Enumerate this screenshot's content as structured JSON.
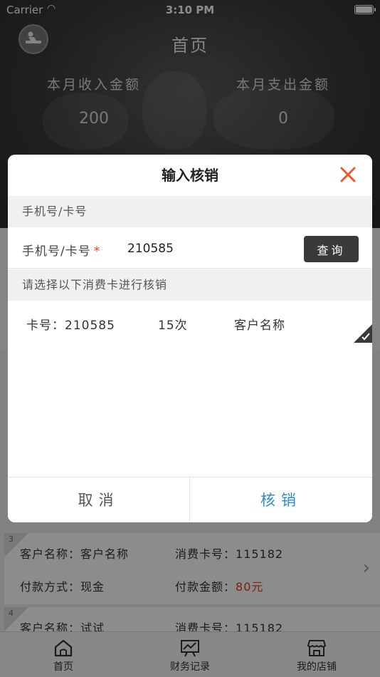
{
  "status_bar": {
    "carrier": "Carrier",
    "time": "3:10 PM"
  },
  "header": {
    "title": "首页",
    "income_label": "本月收入金额",
    "income_value": "200",
    "expense_label": "本月支出金额",
    "expense_value": "0"
  },
  "records": [
    {
      "index": "3",
      "customer_label": "客户名称：",
      "customer_value": "客户名称",
      "card_label": "消费卡号：",
      "card_value": "115182",
      "pay_method_label": "付款方式：",
      "pay_method_value": "现金",
      "amount_label": "付款金额：",
      "amount_value": "80元"
    },
    {
      "index": "4",
      "customer_label": "客户名称：",
      "customer_value": "试试",
      "card_label": "消费卡号：",
      "card_value": "115182"
    }
  ],
  "tabs": [
    {
      "label": "首页",
      "icon": "home-icon"
    },
    {
      "label": "财务记录",
      "icon": "finance-chart-icon"
    },
    {
      "label": "我的店铺",
      "icon": "store-icon"
    }
  ],
  "dialog": {
    "title": "输入核销",
    "section_phone": "手机号/卡号",
    "input_label": "手机号/卡号",
    "required_mark": "*",
    "input_value": "210585",
    "query_label": "查询",
    "section_select": "请选择以下消费卡进行核销",
    "card": {
      "number": "卡号：210585",
      "times": "15次",
      "customer": "客户名称"
    },
    "cancel_label": "取消",
    "confirm_label": "核销"
  },
  "colors": {
    "accent_blue": "#2f8ad6",
    "accent_red": "#e2391f",
    "close_orange": "#ea5a2b"
  }
}
